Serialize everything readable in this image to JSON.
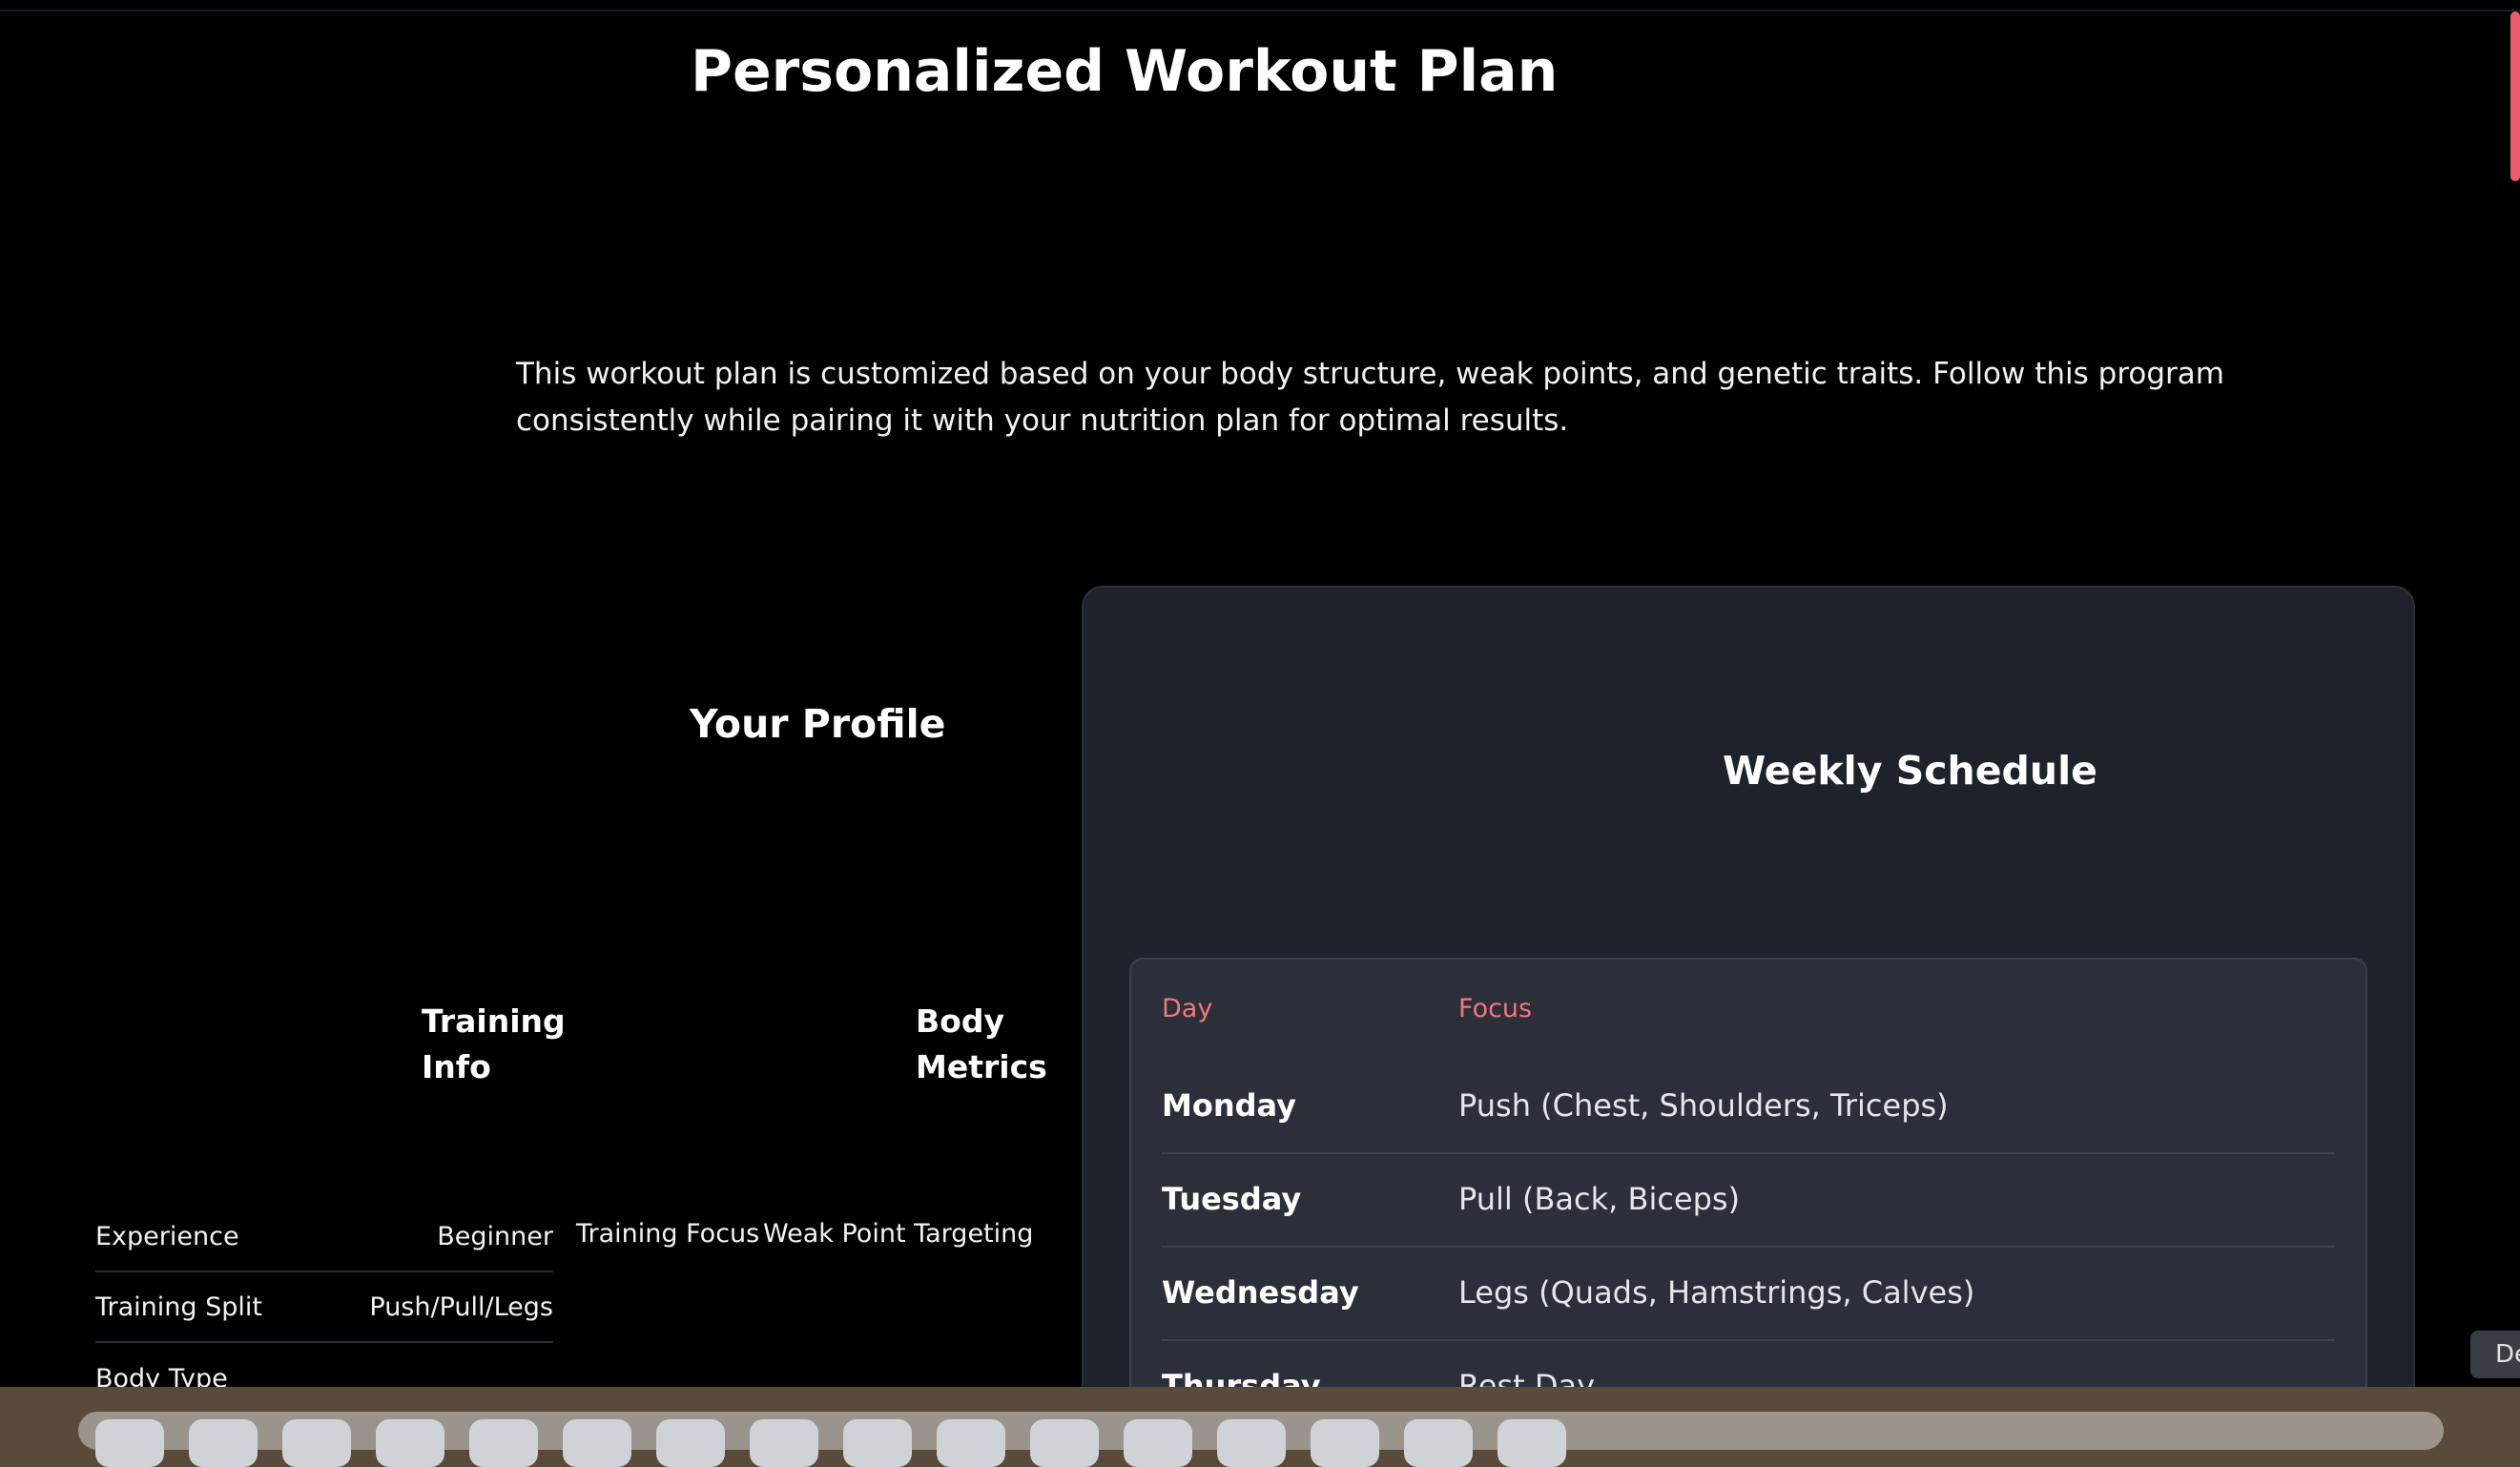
{
  "page": {
    "title": "Personalized Workout Plan",
    "intro": "This workout plan is customized based on your body structure, weak points, and genetic traits. Follow this program consistently while pairing it with your nutrition plan for optimal results."
  },
  "profile": {
    "title": "Your Profile",
    "training_heading": "Training Info",
    "metrics_heading": "Body Metrics",
    "training_info": [
      {
        "label": "Experience",
        "value": "Beginner"
      },
      {
        "label": "Training Split",
        "value": "Push/Pull/Legs"
      },
      {
        "label": "Body Type",
        "value": ""
      }
    ],
    "focus_label": "Training Focus",
    "focus_value": "Weak Point Targeting"
  },
  "schedule": {
    "title": "Weekly Schedule",
    "headers": {
      "day": "Day",
      "focus": "Focus"
    },
    "rows": [
      {
        "day": "Monday",
        "focus": "Push (Chest, Shoulders, Triceps)"
      },
      {
        "day": "Tuesday",
        "focus": "Pull (Back, Biceps)"
      },
      {
        "day": "Wednesday",
        "focus": "Legs (Quads, Hamstrings, Calves)"
      },
      {
        "day": "Thursday",
        "focus": "Rest Day"
      }
    ]
  },
  "side_tab": {
    "label": "De"
  },
  "colors": {
    "accent": "#f0787a",
    "card_bg": "#1e222a",
    "scroll_accent": "#f05a6e"
  }
}
